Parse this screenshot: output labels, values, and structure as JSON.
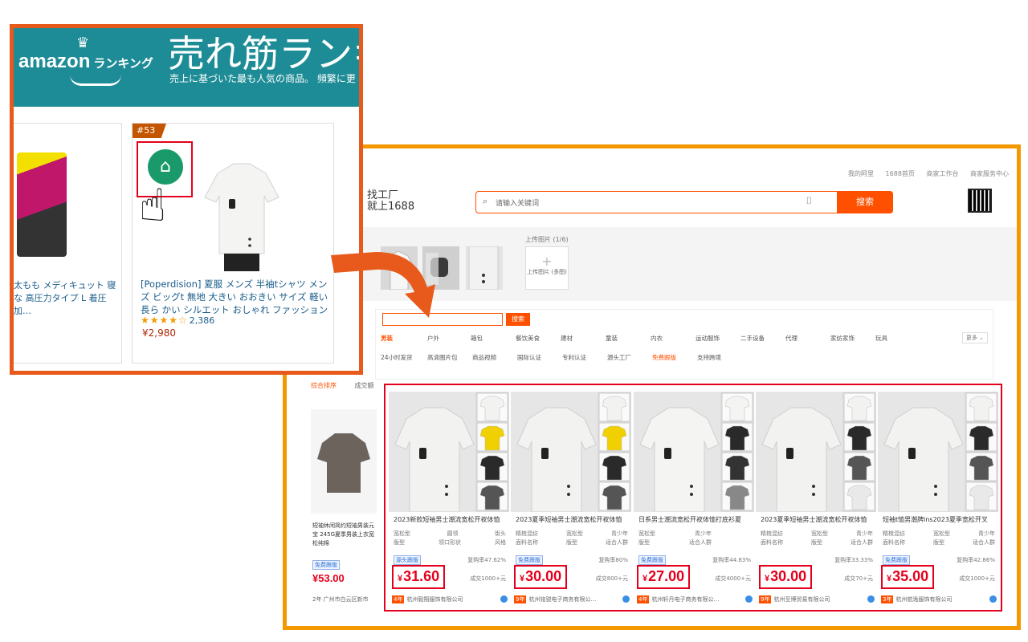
{
  "amazon": {
    "logo": "amazon",
    "logo_suffix": "ランキング",
    "title": "売れ筋ランキ",
    "subtitle": "売上に基づいた最も人気の商品。 頻繁に更",
    "left_product": {
      "title": "太もも メディキュット 寝な 高圧力タイプ L 着圧 加…"
    },
    "product": {
      "rank": "#53",
      "title": "[Poperdision] 夏服 メンズ 半袖tシャツ メンズ ビッグt 無地 大きい おおきい サイズ 軽い 長ら かい シルエット おしゃれ ファッション",
      "stars": "★★★★☆",
      "review_count": "2,386",
      "price": "¥2,980"
    }
  },
  "ali1688": {
    "logo_line1": "找工厂",
    "logo_line2": "就上1688",
    "top_links": [
      "我的阿里",
      "1688首页",
      "商家工作台",
      "商家服务中心"
    ],
    "search_placeholder": "请输入关键词",
    "search_button": "搜索",
    "upload_label": "上传图片 (1/6)",
    "upload_text": "上传图片 (多图)",
    "filter_button": "搜索",
    "categories": [
      "男装",
      "户外",
      "箱包",
      "餐饮美食",
      "建材",
      "童装",
      "内衣",
      "运动服饰",
      "二手设备",
      "代理",
      "家纺家饰",
      "玩具"
    ],
    "more": "更多",
    "services": [
      "24小时发货",
      "高清图片包",
      "商品视频",
      "国际认证",
      "专利认证",
      "源头工厂",
      "免费跟版",
      "支持跨境"
    ],
    "sort": [
      "综合排序",
      "成交额"
    ],
    "first_card": {
      "title": "短袖休闲简约短袖男装元宝 245G夏季男装上衣宽松纯棉",
      "badge": "免费跟版",
      "price": "¥53.00",
      "company": "2年 广州市白云区新市"
    },
    "cards": [
      {
        "title": "2023新款短袖男士潮流宽松开衩体恤",
        "attrs": [
          [
            "宽松型",
            "圆领",
            "街头"
          ],
          [
            "版型",
            "领口形状",
            "风格"
          ]
        ],
        "badge": "源头跟版",
        "repeat": "复购率47.62%",
        "price_yen": "¥",
        "price": "31.60",
        "sold": "成交1000+元",
        "years": "4年",
        "company": "杭州毅翔服饰有限公司"
      },
      {
        "title": "2023夏季短袖男士潮流宽松开衩体恤",
        "attrs": [
          [
            "精梳混纺",
            "宽松型",
            "青少年"
          ],
          [
            "面料名称",
            "版型",
            "适合人群"
          ]
        ],
        "badge": "免费跟版",
        "repeat": "复购率80%",
        "price_yen": "¥",
        "price": "30.00",
        "sold": "成交800+元",
        "years": "9年",
        "company": "杭州铭锐电子商务有限公…"
      },
      {
        "title": "日系男士潮流宽松开衩体恤打底衫夏",
        "attrs": [
          [
            "宽松型",
            "青少年",
            ""
          ],
          [
            "版型",
            "适合人群",
            ""
          ]
        ],
        "badge": "免费跟版",
        "repeat": "复购率44.83%",
        "price_yen": "¥",
        "price": "27.00",
        "sold": "成交4000+元",
        "years": "4年",
        "company": "杭州轩丹电子商务有限公…"
      },
      {
        "title": "2023夏季短袖男士潮流宽松开衩体恤",
        "attrs": [
          [
            "精梳混纺",
            "宽松型",
            "青少年"
          ],
          [
            "面料名称",
            "版型",
            "适合人群"
          ]
        ],
        "badge": "",
        "repeat": "复购率33.33%",
        "price_yen": "¥",
        "price": "30.00",
        "sold": "成交70+元",
        "years": "9年",
        "company": "杭州至博贸易有限公司"
      },
      {
        "title": "短袖t恤男潮牌ins2023夏季宽松开叉",
        "attrs": [
          [
            "精梳混纺",
            "宽松型",
            "青少年"
          ],
          [
            "面料名称",
            "版型",
            "适合人群"
          ]
        ],
        "badge": "免费跟版",
        "repeat": "复购率42.86%",
        "price_yen": "¥",
        "price": "35.00",
        "sold": "成交1000+元",
        "years": "3年",
        "company": "杭州航逸服饰有限公司"
      }
    ]
  },
  "colors": {
    "amazon_frame": "#e85a1c",
    "ali_frame": "#f39800",
    "highlight": "#e4001c",
    "ali_orange": "#ff5000",
    "amazon_teal": "#1d8c96"
  }
}
